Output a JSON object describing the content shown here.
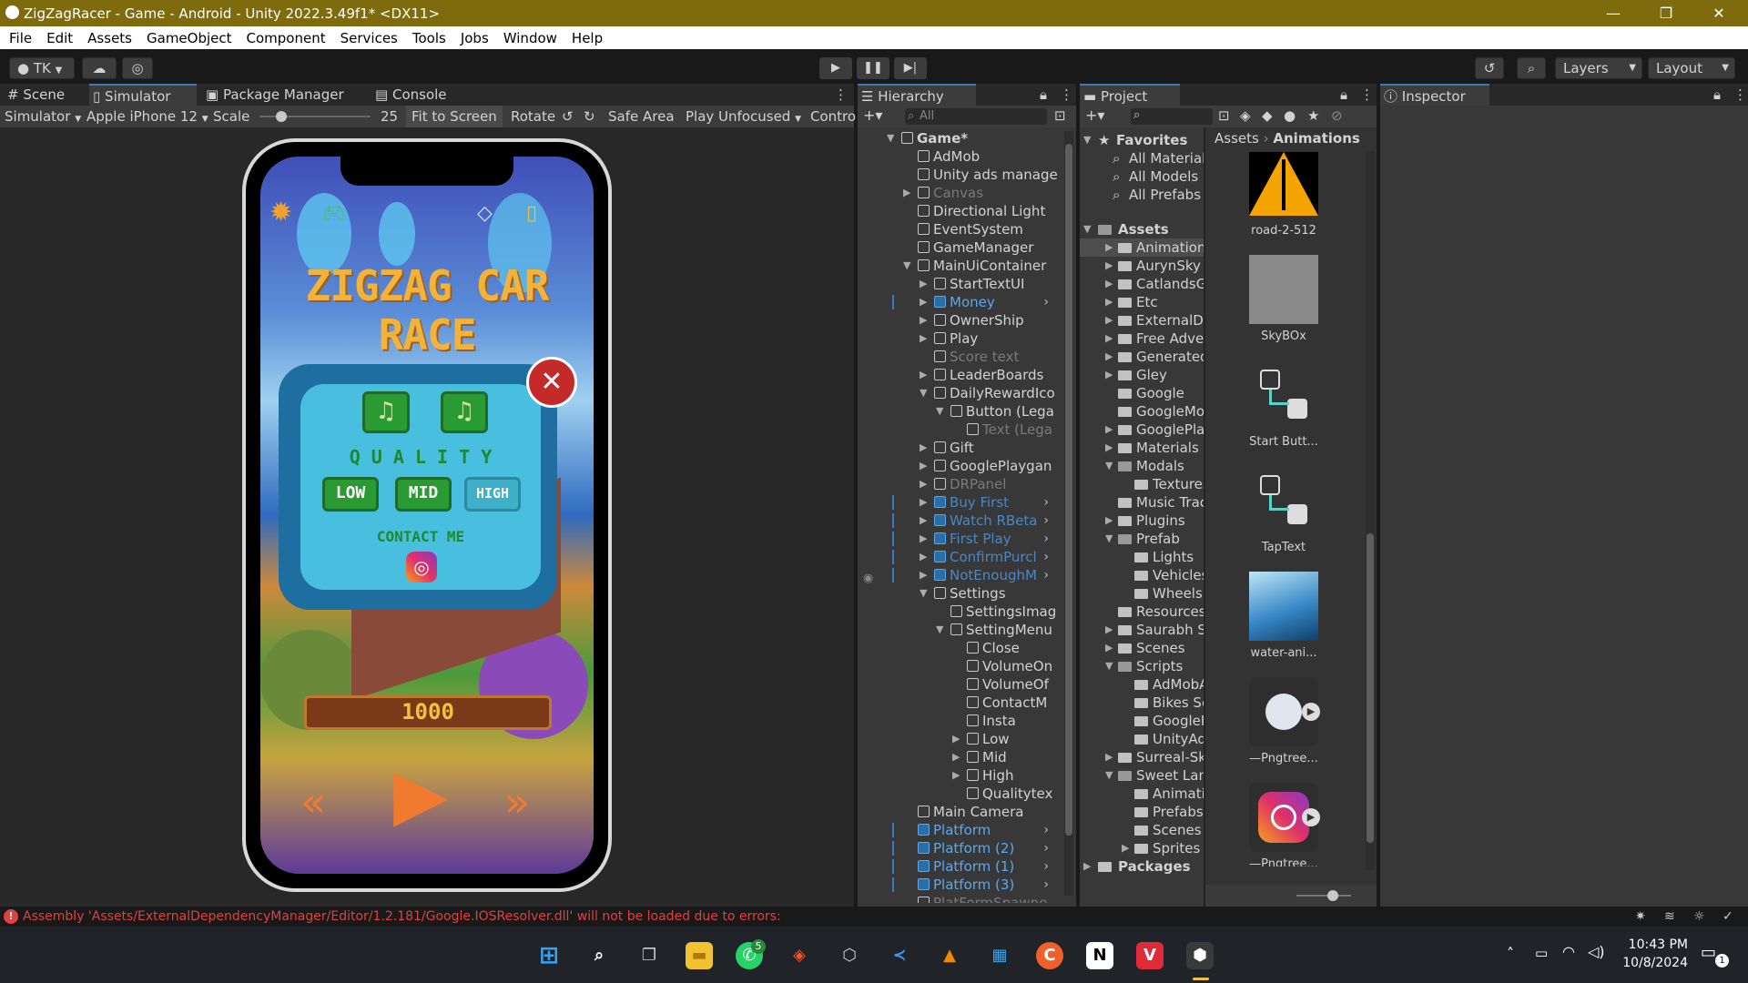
{
  "window": {
    "title": "ZigZagRacer - Game - Android - Unity 2022.3.49f1* <DX11>",
    "minimize": "—",
    "restore": "❐",
    "close": "✕"
  },
  "menu": [
    "File",
    "Edit",
    "Assets",
    "GameObject",
    "Component",
    "Services",
    "Tools",
    "Jobs",
    "Window",
    "Help"
  ],
  "toolbar": {
    "account": "TK",
    "layers": "Layers",
    "layout": "Layout"
  },
  "left_panel": {
    "tabs": [
      "Scene",
      "Simulator",
      "Package Manager",
      "Console"
    ],
    "sim_toolbar": {
      "mode": "Simulator",
      "device": "Apple iPhone 12",
      "scale_label": "Scale",
      "scale_value": "25",
      "scale_fraction": 0.2,
      "fit": "Fit to Screen",
      "rotate": "Rotate",
      "safe_area": "Safe Area",
      "play_focus": "Play Unfocused",
      "control": "Contro"
    }
  },
  "game": {
    "title": "ZIGZAG CAR RACE",
    "quality_label": "Q U A L I T Y",
    "low": "LOW",
    "mid": "MID",
    "high": "HIGH",
    "contact": "CONTACT ME",
    "coins": "1000",
    "close_glyph": "✕"
  },
  "hierarchy": {
    "tab": "Hierarchy",
    "search_placeholder": "All",
    "items": [
      {
        "label": "Game*",
        "depth": 0,
        "expand": "▼",
        "bold": true
      },
      {
        "label": "AdMob",
        "depth": 1
      },
      {
        "label": "Unity ads manage",
        "depth": 1
      },
      {
        "label": "Canvas",
        "depth": 1,
        "expand": "▶",
        "dim": true
      },
      {
        "label": "Directional Light",
        "depth": 1
      },
      {
        "label": "EventSystem",
        "depth": 1
      },
      {
        "label": "GameManager",
        "depth": 1
      },
      {
        "label": "MainUiContainer",
        "depth": 1,
        "expand": "▼"
      },
      {
        "label": "StartTextUI",
        "depth": 2,
        "expand": "▶"
      },
      {
        "label": "Money",
        "depth": 2,
        "expand": "▶",
        "blue": true,
        "chev": true
      },
      {
        "label": "OwnerShip",
        "depth": 2,
        "expand": "▶"
      },
      {
        "label": "Play",
        "depth": 2,
        "expand": "▶"
      },
      {
        "label": "Score text",
        "depth": 2,
        "dim": true
      },
      {
        "label": "LeaderBoards",
        "depth": 2,
        "expand": "▶"
      },
      {
        "label": "DailyRewardIco",
        "depth": 2,
        "expand": "▼"
      },
      {
        "label": "Button (Lega",
        "depth": 3,
        "expand": "▼"
      },
      {
        "label": "Text (Lega",
        "depth": 4,
        "dim": true
      },
      {
        "label": "Gift",
        "depth": 2,
        "expand": "▶"
      },
      {
        "label": "GooglePlaygan",
        "depth": 2,
        "expand": "▶"
      },
      {
        "label": "DRPanel",
        "depth": 2,
        "expand": "▶",
        "dim": true
      },
      {
        "label": "Buy First",
        "depth": 2,
        "expand": "▶",
        "blue": true,
        "dimblue": true,
        "chev": true
      },
      {
        "label": "Watch RBeta",
        "depth": 2,
        "expand": "▶",
        "blue": true,
        "dimblue": true,
        "chev": true
      },
      {
        "label": "First Play",
        "depth": 2,
        "expand": "▶",
        "blue": true,
        "dimblue": true,
        "chev": true
      },
      {
        "label": "ConfirmPurcl",
        "depth": 2,
        "expand": "▶",
        "blue": true,
        "dimblue": true,
        "chev": true
      },
      {
        "label": "NotEnoughM",
        "depth": 2,
        "expand": "▶",
        "blue": true,
        "dimblue": true,
        "chev": true
      },
      {
        "label": "Settings",
        "depth": 2,
        "expand": "▼"
      },
      {
        "label": "SettingsImag",
        "depth": 3
      },
      {
        "label": "SettingMenu",
        "depth": 3,
        "expand": "▼"
      },
      {
        "label": "Close",
        "depth": 4
      },
      {
        "label": "VolumeOn",
        "depth": 4
      },
      {
        "label": "VolumeOf",
        "depth": 4
      },
      {
        "label": "ContactM",
        "depth": 4
      },
      {
        "label": "Insta",
        "depth": 4
      },
      {
        "label": "Low",
        "depth": 4,
        "expand": "▶"
      },
      {
        "label": "Mid",
        "depth": 4,
        "expand": "▶"
      },
      {
        "label": "High",
        "depth": 4,
        "expand": "▶"
      },
      {
        "label": "Qualitytex",
        "depth": 4
      },
      {
        "label": "Main Camera",
        "depth": 1
      },
      {
        "label": "Platform",
        "depth": 1,
        "blue": true,
        "chev": true
      },
      {
        "label": "Platform (2)",
        "depth": 1,
        "blue": true,
        "chev": true
      },
      {
        "label": "Platform (1)",
        "depth": 1,
        "blue": true,
        "chev": true
      },
      {
        "label": "Platform (3)",
        "depth": 1,
        "blue": true,
        "chev": true
      },
      {
        "label": "PlatFormSpawne",
        "depth": 1,
        "dim": true
      }
    ]
  },
  "project": {
    "tab": "Project",
    "breadcrumb": [
      "Assets",
      "Animations"
    ],
    "favorites_label": "Favorites",
    "favorites": [
      "All Material",
      "All Models",
      "All Prefabs"
    ],
    "assets_label": "Assets",
    "tree": [
      {
        "label": "Animations",
        "depth": 1,
        "expand": "▶",
        "selected": true
      },
      {
        "label": "AurynSky",
        "depth": 1,
        "expand": "▶"
      },
      {
        "label": "CatlandsGa",
        "depth": 1,
        "expand": "▶"
      },
      {
        "label": "Etc",
        "depth": 1,
        "expand": "▶"
      },
      {
        "label": "ExternalDe",
        "depth": 1,
        "expand": "▶"
      },
      {
        "label": "Free Adver",
        "depth": 1,
        "expand": "▶"
      },
      {
        "label": "GeneratedL",
        "depth": 1,
        "expand": "▶"
      },
      {
        "label": "Gley",
        "depth": 1,
        "expand": "▶"
      },
      {
        "label": "Google",
        "depth": 1
      },
      {
        "label": "GoogleMob",
        "depth": 1
      },
      {
        "label": "GooglePlay",
        "depth": 1,
        "expand": "▶"
      },
      {
        "label": "Materials",
        "depth": 1,
        "expand": "▶"
      },
      {
        "label": "Modals",
        "depth": 1,
        "expand": "▼"
      },
      {
        "label": "Textures",
        "depth": 2
      },
      {
        "label": "Music Trac",
        "depth": 1
      },
      {
        "label": "Plugins",
        "depth": 1,
        "expand": "▶"
      },
      {
        "label": "Prefab",
        "depth": 1,
        "expand": "▼"
      },
      {
        "label": "Lights",
        "depth": 2
      },
      {
        "label": "Vehicles",
        "depth": 2
      },
      {
        "label": "Wheels",
        "depth": 2
      },
      {
        "label": "Resources",
        "depth": 1
      },
      {
        "label": "Saurabh St",
        "depth": 1,
        "expand": "▶"
      },
      {
        "label": "Scenes",
        "depth": 1,
        "expand": "▶"
      },
      {
        "label": "Scripts",
        "depth": 1,
        "expand": "▼"
      },
      {
        "label": "AdMobA",
        "depth": 2
      },
      {
        "label": "Bikes Sc",
        "depth": 2
      },
      {
        "label": "GoogleP",
        "depth": 2
      },
      {
        "label": "UnityAd:",
        "depth": 2
      },
      {
        "label": "Surreal-Sk",
        "depth": 1,
        "expand": "▶"
      },
      {
        "label": "Sweet Lan",
        "depth": 1,
        "expand": "▼"
      },
      {
        "label": "Animatic",
        "depth": 2
      },
      {
        "label": "Prefabs",
        "depth": 2
      },
      {
        "label": "Scenes",
        "depth": 2
      },
      {
        "label": "Sprites",
        "depth": 2,
        "expand": "▶"
      }
    ],
    "packages_label": "Packages",
    "grid": [
      {
        "label": "road-2-512",
        "kind": "road"
      },
      {
        "label": "SkyBOx",
        "kind": "sky"
      },
      {
        "label": "Start Butt...",
        "kind": "anim"
      },
      {
        "label": "TapText",
        "kind": "anim"
      },
      {
        "label": "water-ani...",
        "kind": "water"
      },
      {
        "label": "—Pngtree...",
        "kind": "moon"
      },
      {
        "label": "—Pngtree...",
        "kind": "insta"
      }
    ]
  },
  "inspector": {
    "tab": "Inspector"
  },
  "status": {
    "message": "Assembly 'Assets/ExternalDependencyManager/Editor/1.2.181/Google.IOSResolver.dll' will not be loaded due to errors:"
  },
  "taskbar": {
    "whatsapp_badge": "5",
    "time": "10:43 PM",
    "date": "10/8/2024",
    "notif_badge": "1"
  },
  "colors": {
    "accent": "#3a79bb",
    "prefab_blue": "#5aa9f0",
    "error": "#e04040",
    "titlebar": "#7d6b0e"
  }
}
